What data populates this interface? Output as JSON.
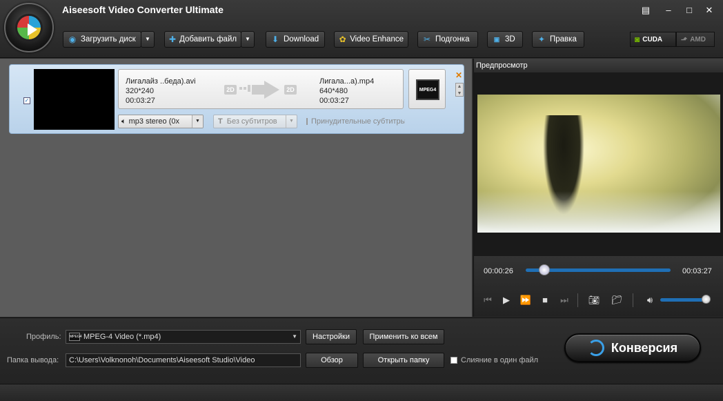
{
  "window": {
    "title": "Aiseesoft Video Converter Ultimate"
  },
  "toolbar": {
    "load_disc": "Загрузить диск",
    "add_file": "Добавить файл",
    "download": "Download",
    "video_enhance": "Video Enhance",
    "trim": "Подгонка",
    "three_d": "3D",
    "edit": "Правка",
    "cuda": "CUDA",
    "amd": "AMD"
  },
  "file_item": {
    "checked": true,
    "source_name": "Лигалайз ..беда).avi",
    "source_resolution": "320*240",
    "source_duration": "00:03:27",
    "badge_2d_left": "2D",
    "badge_2d_right": "2D",
    "output_name": "Лигала...а).mp4",
    "output_resolution": "640*480",
    "output_duration": "00:03:27",
    "format_label": "MPEG4",
    "audio_track": "mp3 stereo (0x",
    "subtitle": "Без субтитров",
    "forced_subtitles": "Принудительные субтитры"
  },
  "preview": {
    "title": "Предпросмотр",
    "current_time": "00:00:26",
    "total_time": "00:03:27",
    "seek_fraction": 0.13,
    "volume_fraction": 0.95
  },
  "bottom": {
    "profile_label": "Профиль:",
    "profile_value": "MPEG-4 Video (*.mp4)",
    "profile_icon_text": "MPEG4",
    "settings_button": "Настройки",
    "apply_all_button": "Применить ко всем",
    "output_label": "Папка вывода:",
    "output_path": "C:\\Users\\Volknonoh\\Documents\\Aiseesoft Studio\\Video",
    "browse_button": "Обзор",
    "open_folder_button": "Открыть папку",
    "merge_label": "Слияние в один файл",
    "convert_button": "Конверсия"
  },
  "colors": {
    "accent_blue": "#1f6fb5",
    "row_highlight": "#c8dcf0",
    "cuda_green": "#76b900"
  }
}
